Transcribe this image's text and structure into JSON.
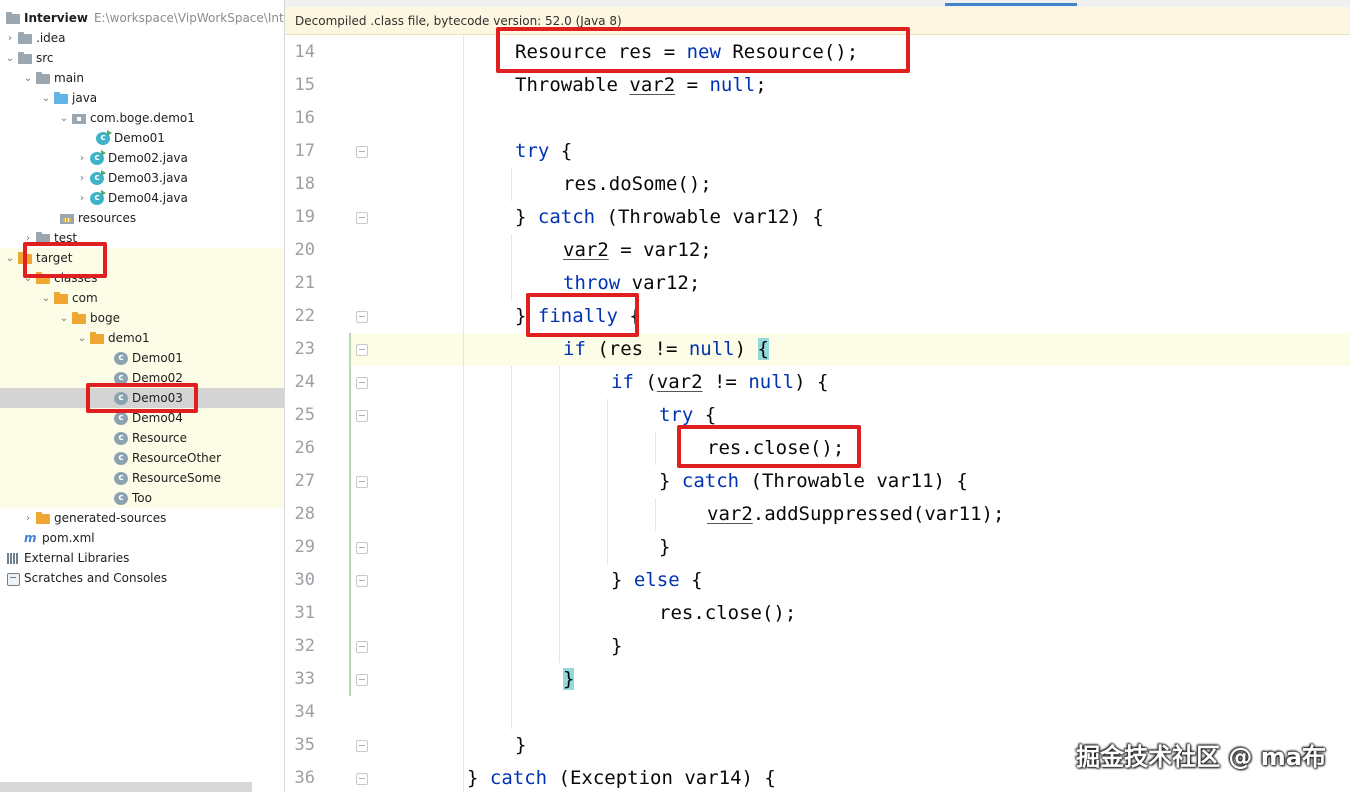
{
  "project_tree": {
    "root": {
      "label": "Interview",
      "path": "E:\\workspace\\VipWorkSpace\\Inte"
    },
    "items": [
      {
        "label": ".idea",
        "icon": "folder-icon"
      },
      {
        "label": "src",
        "icon": "folder-icon"
      },
      {
        "label": "main",
        "icon": "folder-icon"
      },
      {
        "label": "java",
        "icon": "source-folder-icon"
      },
      {
        "label": "com.boge.demo1",
        "icon": "package-icon"
      },
      {
        "label": "Demo01",
        "icon": "java-class-icon"
      },
      {
        "label": "Demo02.java",
        "icon": "java-class-icon"
      },
      {
        "label": "Demo03.java",
        "icon": "java-class-icon"
      },
      {
        "label": "Demo04.java",
        "icon": "java-class-icon"
      },
      {
        "label": "resources",
        "icon": "resources-folder-icon"
      },
      {
        "label": "test",
        "icon": "folder-icon"
      },
      {
        "label": "target",
        "icon": "excluded-folder-icon"
      },
      {
        "label": "classes",
        "icon": "excluded-folder-icon"
      },
      {
        "label": "com",
        "icon": "excluded-folder-icon"
      },
      {
        "label": "boge",
        "icon": "excluded-folder-icon"
      },
      {
        "label": "demo1",
        "icon": "excluded-folder-icon"
      },
      {
        "label": "Demo01",
        "icon": "class-file-icon"
      },
      {
        "label": "Demo02",
        "icon": "class-file-icon"
      },
      {
        "label": "Demo03",
        "icon": "class-file-icon"
      },
      {
        "label": "Demo04",
        "icon": "class-file-icon"
      },
      {
        "label": "Resource",
        "icon": "class-file-icon"
      },
      {
        "label": "ResourceOther",
        "icon": "class-file-icon"
      },
      {
        "label": "ResourceSome",
        "icon": "class-file-icon"
      },
      {
        "label": "Too",
        "icon": "class-file-icon"
      },
      {
        "label": "generated-sources",
        "icon": "excluded-folder-icon"
      },
      {
        "label": "pom.xml",
        "icon": "maven-icon"
      },
      {
        "label": "External Libraries",
        "icon": "library-icon"
      },
      {
        "label": "Scratches and Consoles",
        "icon": "scratch-icon"
      }
    ],
    "selected": "Demo03"
  },
  "editor": {
    "banner": "Decompiled .class file, bytecode version: 52.0 (Java 8)",
    "line_numbers": [
      "14",
      "15",
      "16",
      "17",
      "18",
      "19",
      "20",
      "21",
      "22",
      "23",
      "24",
      "25",
      "26",
      "27",
      "28",
      "29",
      "30",
      "31",
      "32",
      "33",
      "34",
      "35",
      "36"
    ],
    "code": {
      "l14": {
        "t1": "Resource res = ",
        "k1": "new",
        "t2": " Resource();"
      },
      "l15": {
        "t1": "Throwable ",
        "u1": "var2",
        "t2": " = ",
        "k1": "null",
        "t3": ";"
      },
      "l17": {
        "k1": "try",
        "t1": " {"
      },
      "l18": {
        "t1": "res.doSome();"
      },
      "l19": {
        "t1": "} ",
        "k1": "catch",
        "t2": " (Throwable var12) {"
      },
      "l20": {
        "u1": "var2",
        "t1": " = var12;"
      },
      "l21": {
        "k1": "throw",
        "t1": " var12;"
      },
      "l22": {
        "t1": "} ",
        "k1": "finally",
        "t2": " {"
      },
      "l23": {
        "k1": "if",
        "t1": " (res != ",
        "k2": "null",
        "t2": ") ",
        "b1": "{"
      },
      "l24": {
        "k1": "if",
        "t1": " (",
        "u1": "var2",
        "t2": " != ",
        "k2": "null",
        "t3": ") {"
      },
      "l25": {
        "k1": "try",
        "t1": " {"
      },
      "l26": {
        "t1": "res.close();"
      },
      "l27": {
        "t1": "} ",
        "k1": "catch",
        "t2": " (Throwable var11) {"
      },
      "l28": {
        "u1": "var2",
        "t1": ".addSuppressed(var11);"
      },
      "l29": {
        "t1": "}"
      },
      "l30": {
        "t1": "} ",
        "k1": "else",
        "t2": " {"
      },
      "l31": {
        "t1": "res.close();"
      },
      "l32": {
        "t1": "}"
      },
      "l33": {
        "b1": "}"
      },
      "l35": {
        "t1": "}"
      },
      "l36": {
        "t1": "} ",
        "k1": "catch",
        "t2": " (Exception var14) {"
      }
    }
  },
  "watermark": "掘金技术社区 @ ma布",
  "colors": {
    "keyword": "#0033b3",
    "highlight_box": "#e02020",
    "brace_match": "#93d9d9",
    "excluded_band": "#fdfce6"
  }
}
